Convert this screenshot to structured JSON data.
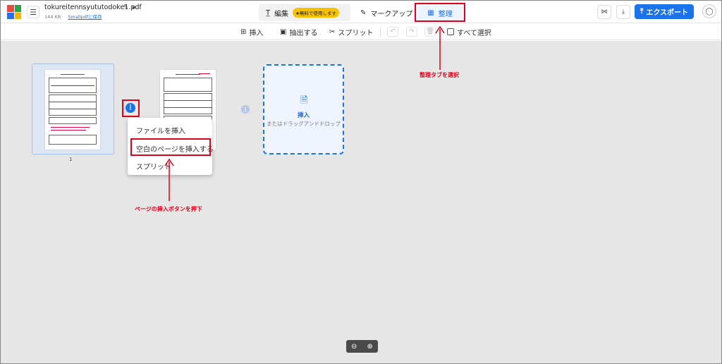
{
  "header": {
    "filename": "tokureitennsyututodoke1.pdf",
    "filesize": "144 KB",
    "save_link": "Smallpdfに保存",
    "tabs": {
      "edit": "編集",
      "edit_badge": "★無料で使用します",
      "markup": "マークアップ",
      "organize": "整理"
    },
    "export_label": "エクスポート"
  },
  "toolbar": {
    "insert": "挿入",
    "extract": "抽出する",
    "split": "スプリット",
    "select_all": "すべて選択"
  },
  "workspace": {
    "page_number": "1",
    "context_menu": {
      "insert_file": "ファイルを挿入",
      "insert_blank": "空白のページを挿入する",
      "split": "スプリット"
    },
    "drop_zone": {
      "title": "挿入",
      "subtitle": "またはドラッグアンドドロップ"
    }
  },
  "annotations": {
    "select_tab": "整理タブを選択",
    "press_insert": "ページの挿入ボタンを押下"
  },
  "colors": {
    "accent": "#1a73e8",
    "annotation_red": "#e0001a",
    "workspace_bg": "#e6e6e6"
  },
  "icons": [
    "hamburger-icon",
    "pin-icon",
    "lock-icon",
    "text-edit-icon",
    "pen-icon",
    "grid-icon",
    "share-icon",
    "download-icon",
    "upload-icon",
    "user-icon",
    "insert-icon",
    "extract-icon",
    "scissors-icon",
    "undo-icon",
    "redo-icon",
    "trash-icon",
    "more-vertical-icon",
    "file-add-icon",
    "zoom-out-icon",
    "zoom-in-icon"
  ]
}
